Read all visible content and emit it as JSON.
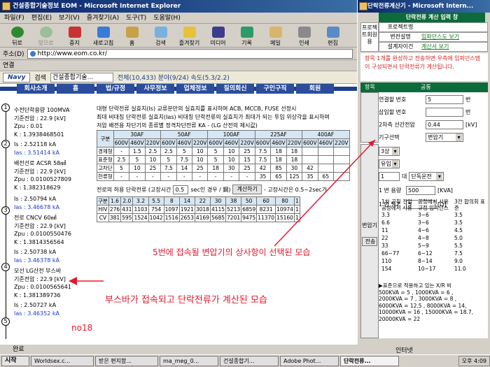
{
  "ie": {
    "title": "건설종합기술정보 EOM - Microsoft Internet Explorer",
    "menu": [
      "파일(F)",
      "편집(E)",
      "보기(V)",
      "즐겨찾기(A)",
      "도구(T)",
      "도움말(H)"
    ],
    "toolbar": [
      "뒤로",
      "앞으로",
      "중지",
      "새로고침",
      "홈",
      "검색",
      "즐겨찾기",
      "미디어",
      "기록",
      "메일",
      "인쇄",
      "편집"
    ],
    "address_label": "주소(D)",
    "address": "http://www.eom.co.kr/",
    "links_label": "연결",
    "navy_label": "Navy",
    "search_label": "검색",
    "search_value": "건설종합기술...",
    "search_stats": "전체(10,433)  분야(9/24)  속도(5.3/2.2)",
    "status": "완료",
    "status_zone": "인터넷"
  },
  "nav": [
    "회사소개",
    "홈",
    "법/규정",
    "사무정보",
    "업체정보",
    "질의회신",
    "구인구직",
    "회원"
  ],
  "diagram": {
    "nodes": [
      "1",
      "2",
      "3",
      "4",
      "5"
    ],
    "lines": [
      {
        "text": "수전단락용량 100MVA",
        "blue": false
      },
      {
        "text": "기준전압 : 22.9 [kV]",
        "blue": false
      },
      {
        "text": "Zpu : 0.01",
        "blue": false
      },
      {
        "text": "K : 1.3938468501",
        "blue": false
      },
      {
        "text": "Is : 2.52118 kA",
        "blue": false
      },
      {
        "text": "Ias : 3.51414 kA",
        "blue": true
      },
      {
        "text": "배전선로 ACSR 58㎟",
        "blue": false
      },
      {
        "text": "기준전압 : 22.9 [kV]",
        "blue": false
      },
      {
        "text": "Zpu : 0.0100527809",
        "blue": false
      },
      {
        "text": "K : 1.382318629",
        "blue": false
      },
      {
        "text": "Is : 2.50794 kA",
        "blue": false
      },
      {
        "text": "Ias : 3.46678 kA",
        "blue": true
      },
      {
        "text": "전로 CNCV 60㎟",
        "blue": false
      },
      {
        "text": "기준전압 : 22.9 [kV]",
        "blue": false
      },
      {
        "text": "Zpu : 0.0100550476",
        "blue": false
      },
      {
        "text": "K : 1.3814356564",
        "blue": false
      },
      {
        "text": "Is : 2.50738 kA",
        "blue": false
      },
      {
        "text": "Ias : 3.46378 kA",
        "blue": true
      },
      {
        "text": "모선 LG산전 부스바",
        "blue": false
      },
      {
        "text": "기준전압 : 22.9 [kV]",
        "blue": false
      },
      {
        "text": "Zpu : 0.0100565641",
        "blue": false
      },
      {
        "text": "K : 1.381389736",
        "blue": false
      },
      {
        "text": "Is : 2.50727 kA",
        "blue": false
      },
      {
        "text": "Ias : 3.46352 kA",
        "blue": true
      }
    ]
  },
  "notes": {
    "line1": "대형 단락전류 실효치(Is)   교류분만의 실효치를 표시하며 ACB, MCCB, FUSE 선정시",
    "line2": "최대 비대칭 단락전류 실효치(Ias)   비대칭 단락전류의 실효치가 최대가 되는 투입 위상각을 표시하며",
    "line3": "저압 배전용 차단기의 종류별 정격차단전류 KA - (LG 산전의 제시값)"
  },
  "breaker_table": {
    "group_header": "구분",
    "groups": [
      "30AF",
      "50AF",
      "100AF",
      "225AF",
      "400AF"
    ],
    "volts": [
      "600V",
      "460V",
      "220V",
      "600V",
      "460V",
      "220V",
      "600V",
      "460V",
      "220V",
      "600V",
      "460V",
      "220V",
      "600V",
      "460V",
      "220V"
    ],
    "rows": [
      {
        "name": "경제형",
        "cells": [
          "-",
          "1.5",
          "2.5",
          "2.5",
          "5",
          "10",
          "5",
          "10",
          "25",
          "7.5",
          "18",
          "18",
          "",
          "",
          ""
        ]
      },
      {
        "name": "표준형",
        "cells": [
          "2.5",
          "5",
          "10",
          "5",
          "7.5",
          "10",
          "5",
          "10",
          "15",
          "7.5",
          "18",
          "18",
          "",
          "",
          ""
        ]
      },
      {
        "name": "고차단",
        "cells": [
          "5",
          "10",
          "25",
          "7.5",
          "14",
          "25",
          "18",
          "30",
          "25",
          "42",
          "85",
          "30",
          "42",
          "",
          ""
        ]
      },
      {
        "name": "한류형",
        "cells": [
          "-",
          "-",
          "-",
          "-",
          "-",
          "-",
          "-",
          "-",
          "-",
          "35",
          "65",
          "125",
          "35",
          "65",
          ""
        ]
      }
    ]
  },
  "calc": {
    "prefix": "전로의 허용 단락전류 (고장시간",
    "time_value": "0.5",
    "suffix": "sec인 경우 / 鋼)",
    "button": "계산하기",
    "result": "- 고장시간은 0.5~2sec가"
  },
  "cable_table": {
    "header": [
      "구분",
      "1.6",
      "2.0",
      "3.2",
      "5.5",
      "8",
      "14",
      "22",
      "30",
      "38",
      "50",
      "60",
      "80",
      "1"
    ],
    "rows": [
      {
        "name": "HIV",
        "cells": [
          "276",
          "431",
          "1103",
          "754",
          "1097",
          "1921",
          "3018",
          "4115",
          "5213",
          "6859",
          "8231",
          "10974",
          "1"
        ]
      },
      {
        "name": "CV",
        "cells": [
          "381",
          "595",
          "1524",
          "1042",
          "1516",
          "2653",
          "4169",
          "5685",
          "7201",
          "9475",
          "11370",
          "15160",
          "1"
        ]
      }
    ]
  },
  "annotations": {
    "transformer": "5번에 접속될 변압기의 상사항이 선택된 모습",
    "busbar": "부스바가 접속되고 단락전류가 계산된 모습",
    "no": "no18"
  },
  "popup": {
    "title": "단락전류계산기 - Microsoft Intern...",
    "header": "단락전류 계산 입력 창",
    "side_label": "프로젝트회원용",
    "info": [
      {
        "label": "프로젝트명",
        "value": ""
      },
      {
        "label": "변전설명",
        "value": "입파던스도 보기"
      },
      {
        "label": "설계자이건",
        "value": "계산서 보기"
      }
    ],
    "message": "항목 1개를 완성하고 전송하면 우측에 임피던스맵이 구성되면서 단락전류가 계산됩니다.",
    "grid_head_left": "항목",
    "grid_head_right": "공통",
    "fields": [
      {
        "label": "연결할 번호",
        "value": "5",
        "unit": "번"
      },
      {
        "label": "삽입할 번호",
        "value": "",
        "unit": "번"
      },
      {
        "label": "2차측 선간전압",
        "value": "0.44",
        "unit": "[kV]"
      },
      {
        "label": "기구선택",
        "value": "변압기",
        "unit": ""
      }
    ],
    "transformer_label": "변압기",
    "phase_select": "3상",
    "oil_select": "유입",
    "count_value": "1",
    "count_unit": "대",
    "unit_select": "단독운전",
    "capacity_label": "1 번 용량",
    "capacity_value": "500",
    "capacity_unit": "[KVA]",
    "z_label": "1 번 %Z",
    "z_value": "5",
    "z_unit": "[Ω]",
    "send_button": "전송",
    "cap_table_head": [
      "1차 공칭 전압 공정에서 사용",
      "공정에서 사용 규정 임피던스",
      "3전 합의회 표준"
    ],
    "cap_table_rows": [
      [
        "3.3",
        "3~6",
        "3.5"
      ],
      [
        "6.6",
        "3~6",
        "3.5"
      ],
      [
        "11",
        "4~6",
        "4.5"
      ],
      [
        "22",
        "4~8",
        "5.0"
      ],
      [
        "33",
        "5~9",
        "5.5"
      ],
      [
        "66~77",
        "6~12",
        "7.5"
      ],
      [
        "110",
        "8~14",
        "9.0"
      ],
      [
        "154",
        "10~17",
        "11.0"
      ]
    ],
    "footnote": "▶표준으로 적용하고 있는 X/R 비",
    "footlines": [
      "500KVA = 5 , 1000KVA = 6 ,",
      "2000KVA = 7 , 3000KVA = 8 ,",
      "6000KVA = 12.5 , 8000KVA = 14,",
      "10000KVA = 16 , 15000KVA = 18.7,",
      "20000KVA = 22"
    ]
  },
  "taskbar": {
    "start": "시작",
    "tasks": [
      "Worldsex.c...",
      "받은 편지함...",
      "ma_meg_0...",
      "건설종합기...",
      "Adobe Phot...",
      "단락전류..."
    ],
    "clock": "오후 4:09"
  },
  "colors": {
    "accent": "#0a246a",
    "popup_green": "#0c6b3a",
    "annot_red": "#e5192e",
    "link_blue": "#1a35d4"
  }
}
